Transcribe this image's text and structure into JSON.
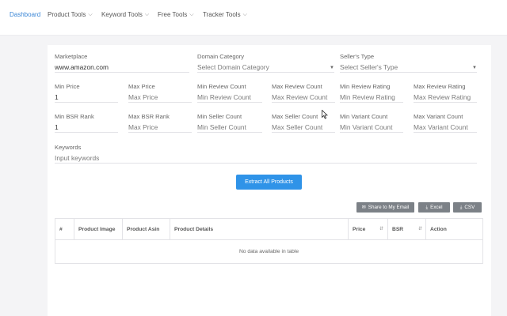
{
  "nav": {
    "items": [
      {
        "label": "Dashboard",
        "caret": false
      },
      {
        "label": "Product Tools",
        "caret": true
      },
      {
        "label": "Keyword Tools",
        "caret": true
      },
      {
        "label": "Free Tools",
        "caret": true
      },
      {
        "label": "Tracker Tools",
        "caret": true
      }
    ]
  },
  "form": {
    "marketplace": {
      "label": "Marketplace",
      "value": "www.amazon.com"
    },
    "domain_category": {
      "label": "Domain Category",
      "placeholder": "Select Domain Category"
    },
    "seller_type": {
      "label": "Seller's Type",
      "placeholder": "Select Seller's Type"
    },
    "min_price": {
      "label": "Min Price",
      "value": "1"
    },
    "max_price": {
      "label": "Max Price",
      "placeholder": "Max Price"
    },
    "min_review_count": {
      "label": "Min Review Count",
      "placeholder": "Min Review Count"
    },
    "max_review_count": {
      "label": "Max Review Count",
      "placeholder": "Max Review Count"
    },
    "min_review_rating": {
      "label": "Min Review Rating",
      "placeholder": "Min Review Rating"
    },
    "max_review_rating": {
      "label": "Max Review Rating",
      "placeholder": "Max Review Rating"
    },
    "min_bsr_rank": {
      "label": "Min BSR Rank",
      "value": "1"
    },
    "max_bsr_rank": {
      "label": "Max BSR Rank",
      "placeholder": "Max Price"
    },
    "min_seller_count": {
      "label": "Min Seller Count",
      "placeholder": "Min Seller Count"
    },
    "max_seller_count": {
      "label": "Max Seller Count",
      "placeholder": "Max Seller Count"
    },
    "min_variant_count": {
      "label": "Min Variant Count",
      "placeholder": "Min Variant Count"
    },
    "max_variant_count": {
      "label": "Max Variant Count",
      "placeholder": "Max Variant Count"
    },
    "keywords": {
      "label": "Keywords",
      "placeholder": "Input keywords"
    }
  },
  "actions": {
    "extract": "Extract All Products",
    "share_email": "Share to My Email",
    "excel": "Excel",
    "csv": "CSV"
  },
  "table": {
    "columns": [
      "#",
      "Product Image",
      "Product Asin",
      "Product Details",
      "Price",
      "BSR",
      "Action"
    ],
    "empty_message": "No data available in table"
  },
  "colors": {
    "primary": "#2f93e8",
    "nav_active": "#3a86d6",
    "secondary_button": "#7c8187"
  },
  "icons": {
    "dropdown": "chevron-down-icon",
    "share": "envelope-icon",
    "download": "download-icon",
    "sort": "sort-icon"
  }
}
